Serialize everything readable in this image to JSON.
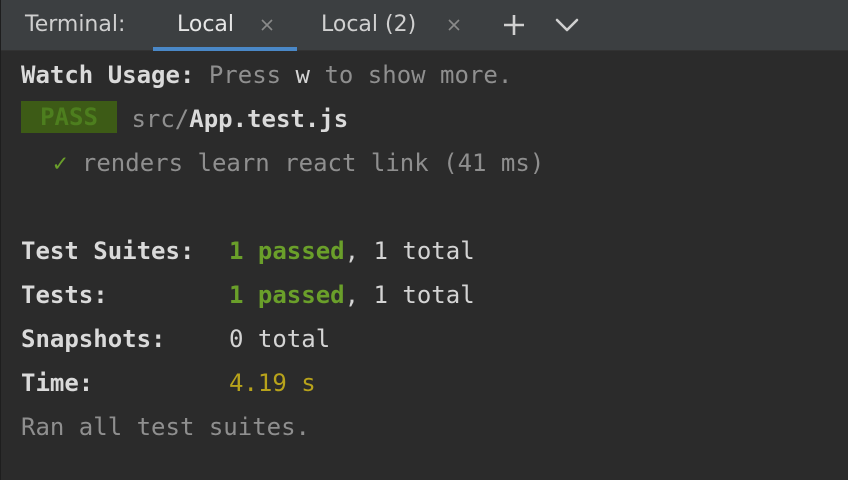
{
  "header": {
    "title": "Terminal:",
    "tabs": [
      {
        "label": "Local",
        "active": true
      },
      {
        "label": "Local (2)",
        "active": false
      }
    ],
    "add_icon": "plus-icon",
    "more_icon": "chevron-down-icon",
    "close_icon": "close-icon"
  },
  "terminal": {
    "watch_usage": {
      "label": "Watch Usage:",
      "press": "Press",
      "key": "w",
      "rest": "to show more."
    },
    "result": {
      "badge": "PASS",
      "path": "src/",
      "file": "App.test.js"
    },
    "test_case": {
      "check": "✓",
      "text": "renders learn react link (41 ms)"
    },
    "summary": {
      "suites": {
        "label": "Test Suites:",
        "passed": "1 passed",
        "sep": ",",
        "total": "1 total"
      },
      "tests": {
        "label": "Tests:",
        "passed": "1 passed",
        "sep": ",",
        "total": "1 total"
      },
      "snapshots": {
        "label": "Snapshots:",
        "total": "0 total"
      },
      "time": {
        "label": "Time:",
        "value": "4.19 s"
      }
    },
    "footer": "Ran all test suites."
  },
  "colors": {
    "background": "#2b2b2b",
    "header_bg": "#3c3f41",
    "active_tab_underline": "#4a88c7",
    "pass_badge_bg": "#3d5b16",
    "pass_green": "#6a9f2a",
    "time_yellow": "#b8a31b"
  }
}
